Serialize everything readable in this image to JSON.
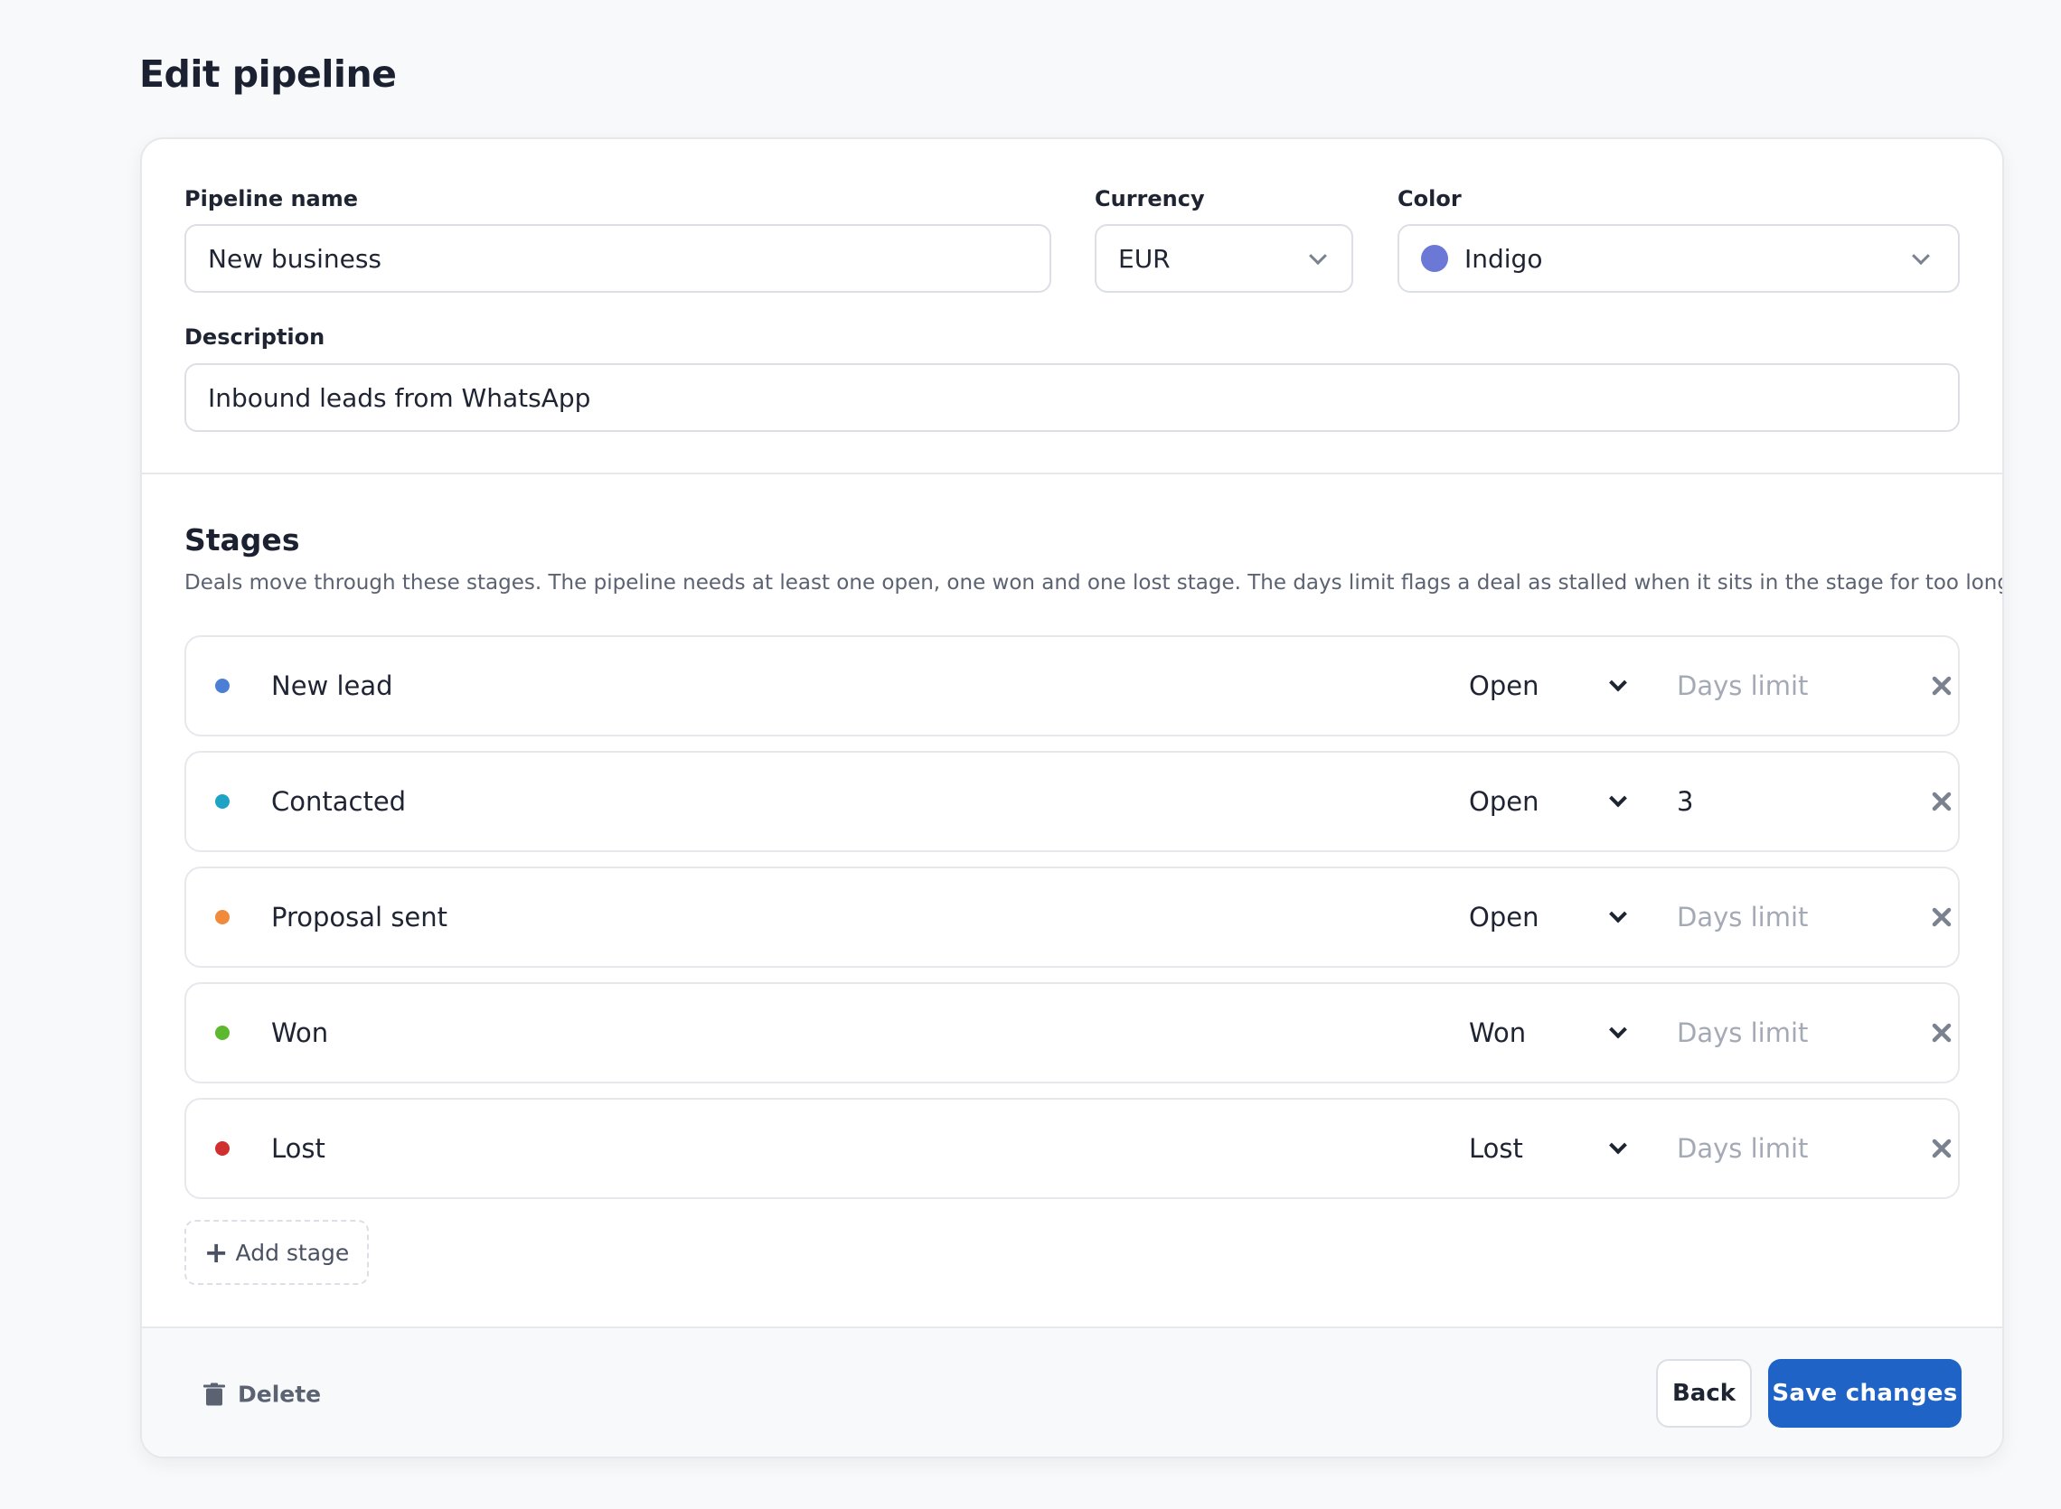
{
  "page": {
    "title": "Edit pipeline"
  },
  "form": {
    "name": {
      "label": "Pipeline name",
      "value": "New business"
    },
    "currency": {
      "label": "Currency",
      "value": "EUR"
    },
    "color": {
      "label": "Color",
      "value": "Indigo",
      "swatch": "#6b78d6"
    },
    "description": {
      "label": "Description",
      "value": "Inbound leads from WhatsApp"
    }
  },
  "stages": {
    "heading": "Stages",
    "description": "Deals move through these stages. The pipeline needs at least one open, one won and one lost stage. The days limit flags a deal as stalled when it sits in the stage for too long.",
    "days_placeholder": "Days limit",
    "items": [
      {
        "name": "New lead",
        "type": "Open",
        "days": "",
        "color": "#4a7fd4"
      },
      {
        "name": "Contacted",
        "type": "Open",
        "days": "3",
        "color": "#1fa3c4"
      },
      {
        "name": "Proposal sent",
        "type": "Open",
        "days": "",
        "color": "#f28a3c"
      },
      {
        "name": "Won",
        "type": "Won",
        "days": "",
        "color": "#5cb82e"
      },
      {
        "name": "Lost",
        "type": "Lost",
        "days": "",
        "color": "#d12f2f"
      }
    ],
    "add_label": "Add stage"
  },
  "footer": {
    "delete_label": "Delete",
    "back_label": "Back",
    "save_label": "Save changes"
  },
  "colors": {
    "accent": "#1f63c6"
  }
}
